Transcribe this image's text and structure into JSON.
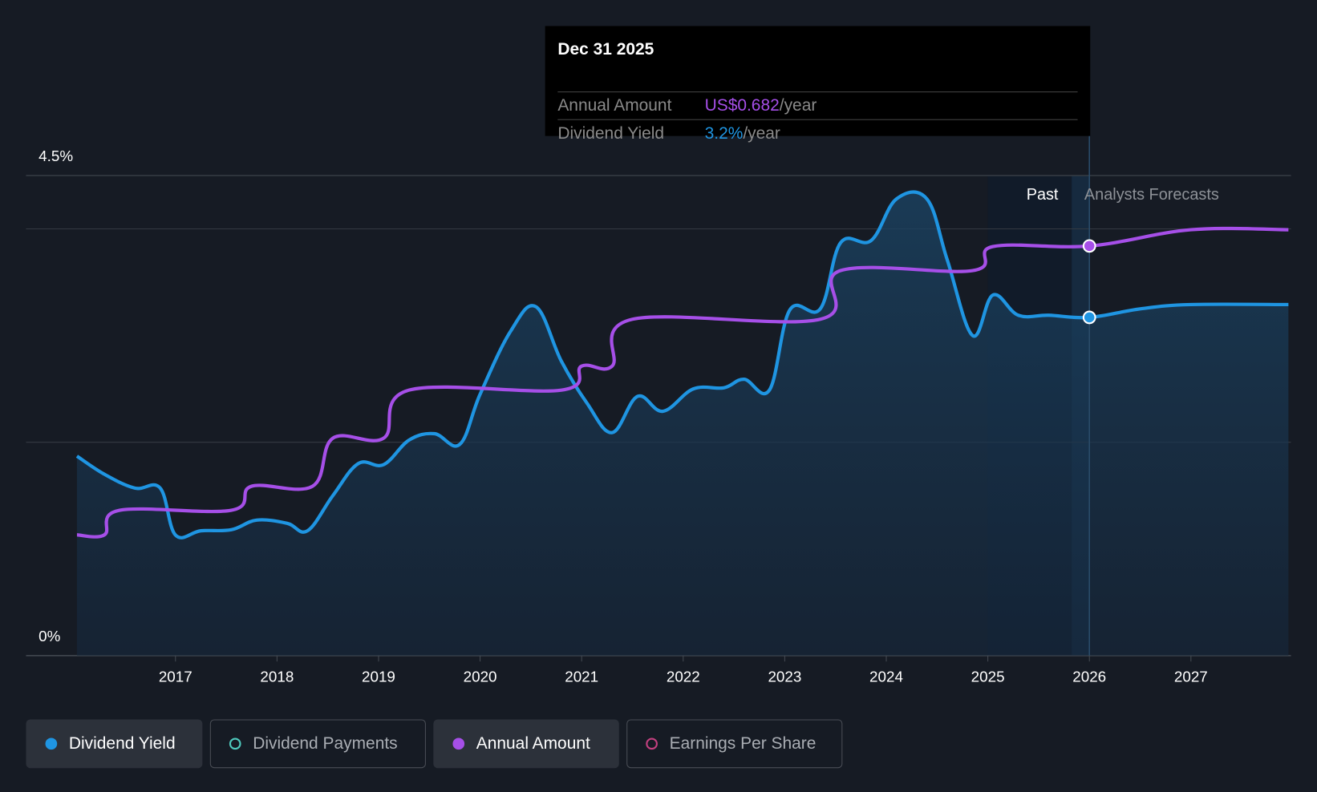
{
  "tooltip": {
    "date": "Dec 31 2025",
    "rows": [
      {
        "label": "Annual Amount",
        "value": "US$0.682",
        "suffix": "/year",
        "color": "#a64fe8"
      },
      {
        "label": "Dividend Yield",
        "value": "3.2%",
        "suffix": "/year",
        "color": "#1f95e2"
      }
    ]
  },
  "regions": {
    "past": "Past",
    "forecast": "Analysts Forecasts"
  },
  "legend": [
    {
      "label": "Dividend Yield",
      "color": "#1f95e2",
      "active": true
    },
    {
      "label": "Dividend Payments",
      "color": "#4fc9bd",
      "active": false
    },
    {
      "label": "Annual Amount",
      "color": "#a64fe8",
      "active": true
    },
    {
      "label": "Earnings Per Share",
      "color": "#c2407f",
      "active": false
    }
  ],
  "chart_data": {
    "type": "line",
    "y_tick_labels": [
      "4.5%",
      "0%"
    ],
    "ylim": [
      0,
      4.5
    ],
    "gridlines": [
      0,
      2,
      4,
      4.5
    ],
    "x_tick_labels": [
      "2017",
      "2018",
      "2019",
      "2020",
      "2021",
      "2022",
      "2023",
      "2024",
      "2025",
      "2026",
      "2027"
    ],
    "xlim": [
      2016,
      2028
    ],
    "past_region": [
      2025,
      2026
    ],
    "highlight_x": 2026,
    "series": [
      {
        "name": "Dividend Yield",
        "unit": "%",
        "color": "#1f95e2",
        "x": [
          2016.03,
          2016.3,
          2016.6,
          2016.85,
          2017,
          2017.25,
          2017.55,
          2017.8,
          2018.1,
          2018.3,
          2018.55,
          2018.8,
          2019.05,
          2019.3,
          2019.55,
          2019.8,
          2020,
          2020.3,
          2020.55,
          2020.8,
          2021.05,
          2021.3,
          2021.55,
          2021.8,
          2022.1,
          2022.4,
          2022.6,
          2022.85,
          2023.05,
          2023.35,
          2023.55,
          2023.85,
          2024.1,
          2024.4,
          2024.6,
          2024.85,
          2025.05,
          2025.3,
          2025.6,
          2026,
          2026.5,
          2027,
          2027.96
        ],
        "y": [
          1.87,
          1.7,
          1.57,
          1.57,
          1.13,
          1.17,
          1.18,
          1.27,
          1.24,
          1.17,
          1.5,
          1.8,
          1.79,
          2.02,
          2.08,
          1.98,
          2.45,
          3.04,
          3.27,
          2.76,
          2.37,
          2.09,
          2.43,
          2.29,
          2.5,
          2.51,
          2.59,
          2.49,
          3.24,
          3.25,
          3.87,
          3.89,
          4.28,
          4.28,
          3.71,
          3.0,
          3.38,
          3.19,
          3.19,
          3.17,
          3.25,
          3.29,
          3.29
        ]
      },
      {
        "name": "Annual Amount",
        "unit": "US$/year",
        "color": "#a64fe8",
        "x": [
          2016.03,
          2016.3,
          2016.45,
          2017.55,
          2017.75,
          2018.35,
          2018.55,
          2019.05,
          2019.3,
          2020.8,
          2021.0,
          2021.3,
          2021.5,
          2023.35,
          2023.55,
          2024.85,
          2025.05,
          2026,
          2027,
          2027.96
        ],
        "y": [
          0.201,
          0.201,
          0.242,
          0.242,
          0.282,
          0.282,
          0.362,
          0.362,
          0.442,
          0.442,
          0.482,
          0.482,
          0.56,
          0.56,
          0.641,
          0.641,
          0.681,
          0.682,
          0.709,
          0.709
        ]
      }
    ]
  }
}
